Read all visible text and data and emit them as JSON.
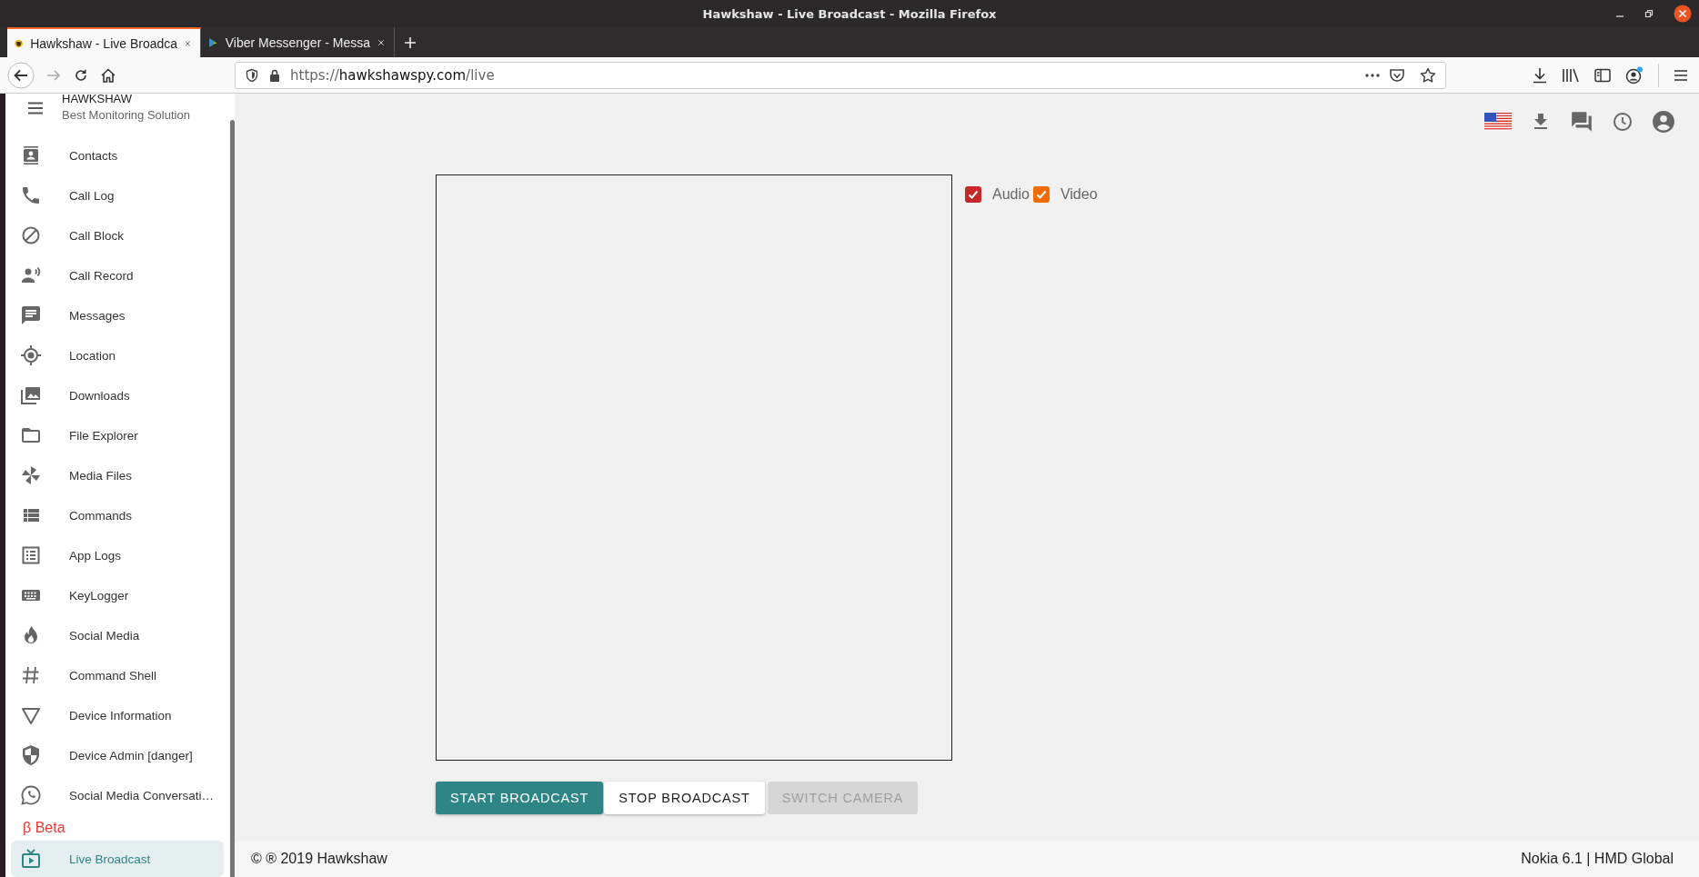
{
  "window": {
    "title": "Hawkshaw - Live Broadcast - Mozilla Firefox"
  },
  "tabs": [
    {
      "label": "Hawkshaw - Live Broadca",
      "selected": true
    },
    {
      "label": "Viber Messenger - Messa",
      "selected": false
    }
  ],
  "address_bar": {
    "scheme": "https://",
    "host": "hawkshawspy.com",
    "path": "/live"
  },
  "sidebar": {
    "title": "HAWKSHAW",
    "subtitle": "Best Monitoring Solution",
    "items": [
      {
        "label": "Contacts",
        "selected": false
      },
      {
        "label": "Call Log",
        "selected": false
      },
      {
        "label": "Call Block",
        "selected": false
      },
      {
        "label": "Call Record",
        "selected": false
      },
      {
        "label": "Messages",
        "selected": false
      },
      {
        "label": "Location",
        "selected": false
      },
      {
        "label": "Downloads",
        "selected": false
      },
      {
        "label": "File Explorer",
        "selected": false
      },
      {
        "label": "Media Files",
        "selected": false
      },
      {
        "label": "Commands",
        "selected": false
      },
      {
        "label": "App Logs",
        "selected": false
      },
      {
        "label": "KeyLogger",
        "selected": false
      },
      {
        "label": "Social Media",
        "selected": false
      },
      {
        "label": "Command Shell",
        "selected": false
      },
      {
        "label": "Device Information",
        "selected": false
      },
      {
        "label": "Device Admin [danger]",
        "selected": false
      },
      {
        "label": "Social Media Conversati…",
        "selected": false
      }
    ],
    "section_label": "β Beta",
    "beta_items": [
      {
        "label": "Live Broadcast",
        "selected": true
      }
    ]
  },
  "options": [
    {
      "label": "Audio",
      "checked": true,
      "color": "#c62828"
    },
    {
      "label": "Video",
      "checked": true,
      "color": "#ef6c00"
    }
  ],
  "buttons": [
    {
      "label": "START BROADCAST",
      "kind": "primary",
      "disabled": false
    },
    {
      "label": "STOP BROADCAST",
      "kind": "plain",
      "disabled": false
    },
    {
      "label": "SWITCH CAMERA",
      "kind": "plain",
      "disabled": true
    }
  ],
  "footer": {
    "copyright": "© ® 2019 Hawkshaw",
    "device": "Nokia 6.1 | HMD Global"
  }
}
